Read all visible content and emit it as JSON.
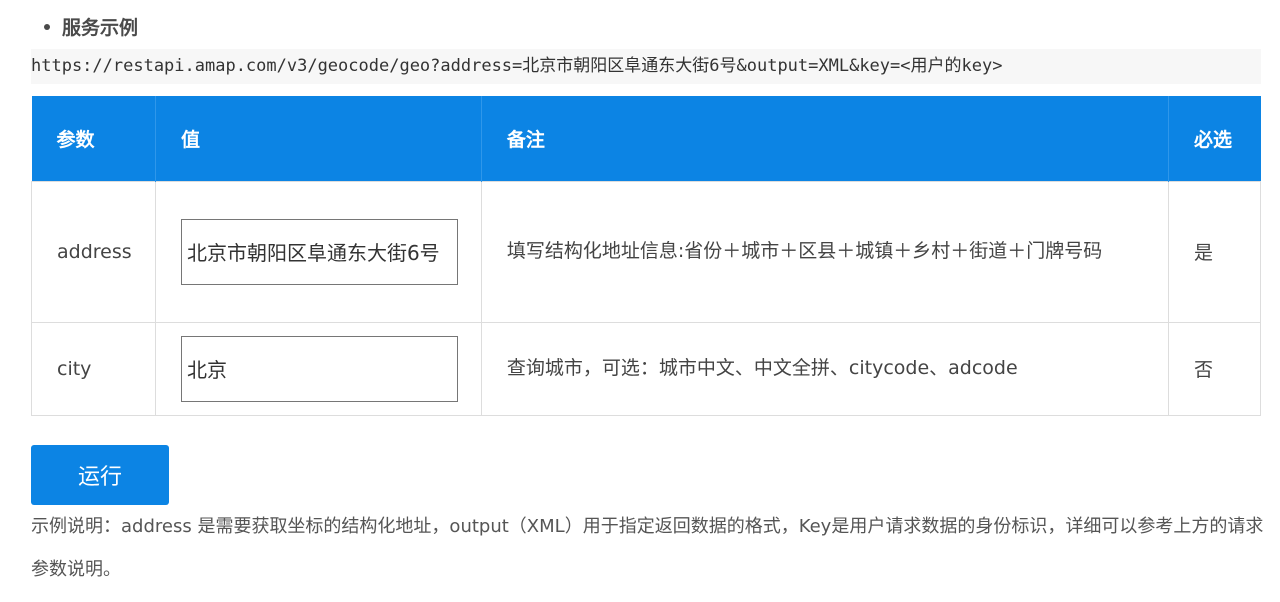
{
  "section": {
    "title": "服务示例"
  },
  "request_url": "https://restapi.amap.com/v3/geocode/geo?address=北京市朝阳区阜通东大街6号&output=XML&key=<用户的key>",
  "table": {
    "headers": {
      "param": "参数",
      "value": "值",
      "note": "备注",
      "required": "必选"
    },
    "rows": [
      {
        "param": "address",
        "value": "北京市朝阳区阜通东大街6号",
        "note": "填写结构化地址信息:省份＋城市＋区县＋城镇＋乡村＋街道＋门牌号码",
        "required": "是"
      },
      {
        "param": "city",
        "value": "北京",
        "note": "查询城市，可选：城市中文、中文全拼、citycode、adcode",
        "required": "否"
      }
    ]
  },
  "run_button": {
    "label": "运行"
  },
  "description": "示例说明：address 是需要获取坐标的结构化地址，output（XML）用于指定返回数据的格式，Key是用户请求数据的身份标识，详细可以参考上方的请求参数说明。",
  "colors": {
    "accent": "#0c84e4",
    "url_bg": "#f7f7f7",
    "border": "#dddddd"
  }
}
